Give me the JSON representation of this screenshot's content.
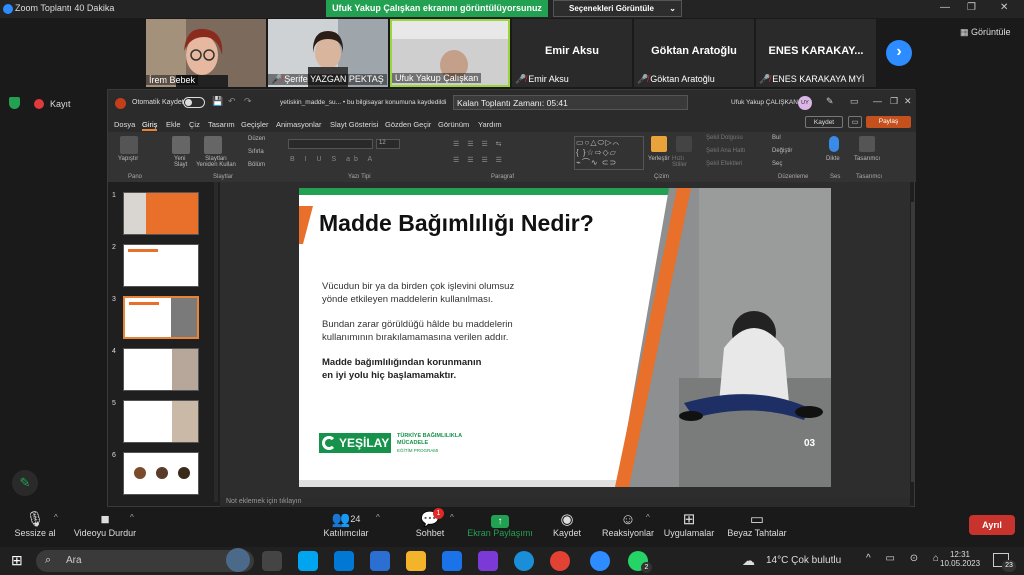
{
  "window": {
    "title": "Zoom Toplantı 40 Dakika"
  },
  "share_banner": "Ufuk Yakup Çalışkan ekranını görüntülüyorsunuz",
  "view_options": "Seçenekleri Görüntüle",
  "gallery_view": "Görüntüle",
  "participants": [
    {
      "name": "İrem Bebek",
      "video": true
    },
    {
      "name": "Şerife YAZGAN PEKTAŞ",
      "video": true,
      "muted": true
    },
    {
      "name": "Ufuk Yakup Çalışkan",
      "video": true
    },
    {
      "name": "Emir Aksu",
      "video": false,
      "muted": true
    },
    {
      "name": "Göktan Aratoğlu",
      "video": false,
      "muted": true
    },
    {
      "name": "ENES KARAKAYA MYİ",
      "display": "ENES KARAKAY...",
      "video": false,
      "muted": true
    }
  ],
  "record": {
    "label": "Kayıt"
  },
  "ppt": {
    "autosave_label": "Otomatik Kaydet",
    "filename": "yetiskin_madde_su... • bu bilgisayar konumuna kaydedildi",
    "timer_tooltip": "Kalan Toplantı Zamanı: 05:41",
    "user_name": "Ufuk Yakup ÇALIŞKAN",
    "user_initials": "UY",
    "save_btn": "Kaydet",
    "share_btn": "Paylaş",
    "menu": [
      "Dosya",
      "Giriş",
      "Ekle",
      "Çiz",
      "Tasarım",
      "Geçişler",
      "Animasyonlar",
      "Slayt Gösterisi",
      "Gözden Geçir",
      "Görünüm",
      "Yardım"
    ],
    "ribbon": {
      "paste": "Yapıştır",
      "new_slide": "Yeni Slayt",
      "reuse": "Slaytları Yeniden Kullan",
      "layout": "Düzen",
      "reset": "Sıfırla",
      "section": "Bölüm",
      "arrange": "Yerleştir",
      "quick_styles": "Hızlı Stiller",
      "shape_fill": "Şekil Dolgusu",
      "shape_outline": "Şekil Ana Hattı",
      "shape_effects": "Şekil Efektleri",
      "find": "Bul",
      "replace": "Değiştir",
      "select": "Seç",
      "dictate": "Dikte",
      "designer": "Tasarımcı",
      "groups": [
        "Pano",
        "Slaytlar",
        "Yazı Tipi",
        "Paragraf",
        "Çizim",
        "Düzenleme",
        "Ses",
        "Tasarımcı"
      ],
      "font_size": "12"
    },
    "thumb_numbers": [
      "1",
      "2",
      "3",
      "4",
      "5",
      "6"
    ],
    "notes_placeholder": "Not eklemek için tıklayın"
  },
  "slide": {
    "title": "Madde Bağımlılığı Nedir?",
    "p1": [
      "Vücudun bir ya da birden çok işlevini olumsuz",
      "yönde etkileyen maddelerin kullanılması."
    ],
    "p2": [
      "Bundan zarar görüldüğü hâlde bu maddelerin",
      "kullanımının bırakılamamasına verilen addır."
    ],
    "p3": [
      "Madde bağımlılığından korunmanın",
      "en iyi yolu hiç başlamamaktır."
    ],
    "logo_text": "YEŞİLAY",
    "program": [
      "TÜRKİYE BAĞIMLILIKLA",
      "MÜCADELE",
      "EĞİTİM PROGRAMI"
    ],
    "page_number": "03"
  },
  "toolbar": {
    "mute": "Sessize al",
    "video": "Videoyu Durdur",
    "participants": "Katılımcılar",
    "participant_count": "24",
    "chat": "Sohbet",
    "chat_badge": "1",
    "share": "Ekran Paylaşımı",
    "record": "Kaydet",
    "reactions": "Reaksiyonlar",
    "apps": "Uygulamalar",
    "whiteboard": "Beyaz Tahtalar",
    "leave": "Ayrıl"
  },
  "taskbar": {
    "search_placeholder": "Ara",
    "weather": "14°C  Çok bulutlu",
    "time": "12:31",
    "date": "10.05.2023",
    "notif_count": "23",
    "whatsapp_badge": "2"
  },
  "colors": {
    "zoom_blue": "#2d8cff",
    "share_green": "#23a152",
    "leave_red": "#c8332e",
    "slide_orange": "#e8702a",
    "yesilay_green": "#16924a"
  }
}
